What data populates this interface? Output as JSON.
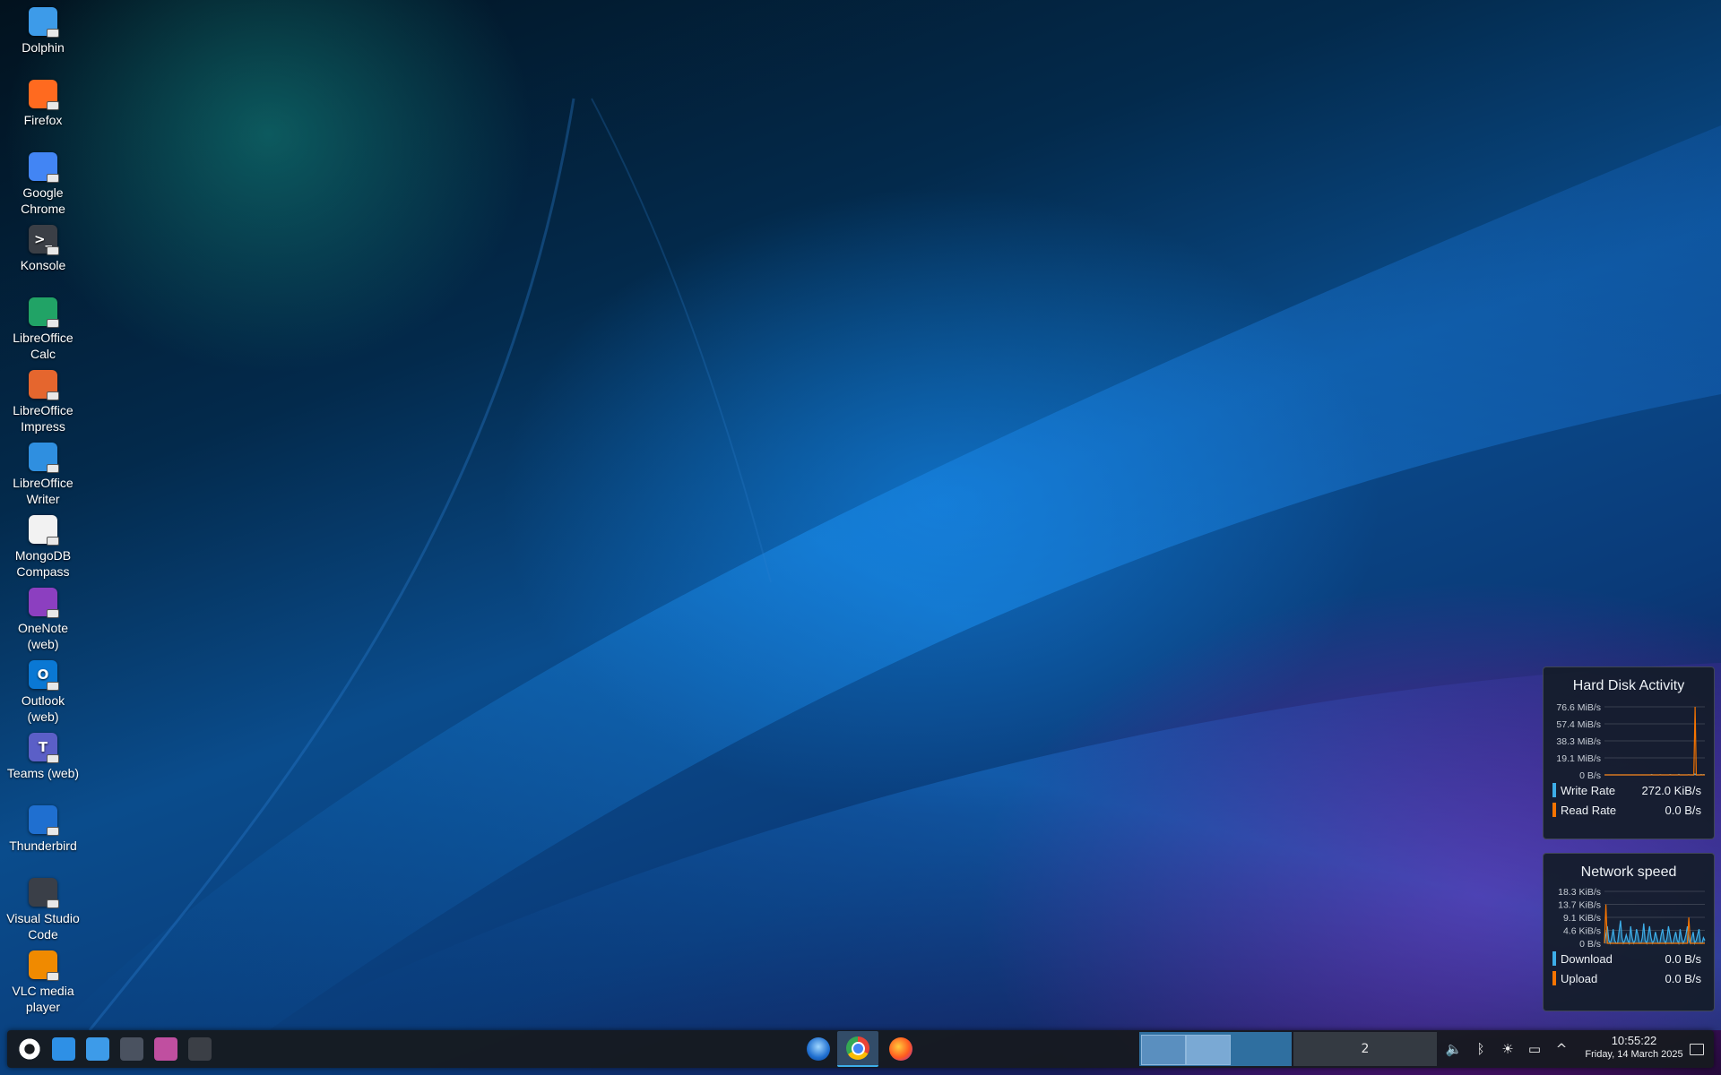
{
  "desktop_icons": [
    {
      "label": "Dolphin",
      "icon": "folder-icon",
      "color": "#3d9be9",
      "glyph": ""
    },
    {
      "label": "Firefox",
      "icon": "firefox-icon",
      "color": "#ff6a1f",
      "glyph": ""
    },
    {
      "label": "Google Chrome",
      "icon": "chrome-icon",
      "color": "#4285f4",
      "glyph": ""
    },
    {
      "label": "Konsole",
      "icon": "terminal-icon",
      "color": "#3b3f46",
      "glyph": ">_"
    },
    {
      "label": "LibreOffice Calc",
      "icon": "spreadsheet-icon",
      "color": "#21a366",
      "glyph": ""
    },
    {
      "label": "LibreOffice Impress",
      "icon": "presentation-icon",
      "color": "#e5662e",
      "glyph": ""
    },
    {
      "label": "LibreOffice Writer",
      "icon": "document-icon",
      "color": "#2f8fe0",
      "glyph": ""
    },
    {
      "label": "MongoDB Compass",
      "icon": "mongodb-leaf-icon",
      "color": "#f2f2f2",
      "glyph": ""
    },
    {
      "label": "OneNote (web)",
      "icon": "onenote-icon",
      "color": "#8c3fc0",
      "glyph": ""
    },
    {
      "label": "Outlook (web)",
      "icon": "outlook-icon",
      "color": "#0a78d4",
      "glyph": "O"
    },
    {
      "label": "Teams (web)",
      "icon": "teams-icon",
      "color": "#5b5fc7",
      "glyph": "T"
    },
    {
      "label": "Thunderbird",
      "icon": "thunderbird-icon",
      "color": "#1f6fd0",
      "glyph": ""
    },
    {
      "label": "Visual Studio Code",
      "icon": "vscode-icon",
      "color": "#3a3f48",
      "glyph": ""
    },
    {
      "label": "VLC media player",
      "icon": "vlc-cone-icon",
      "color": "#f08a00",
      "glyph": ""
    }
  ],
  "disk_widget": {
    "title": "Hard Disk Activity",
    "y_ticks": [
      "76.6 MiB/s",
      "57.4 MiB/s",
      "38.3 MiB/s",
      "19.1 MiB/s",
      "0 B/s"
    ],
    "legend": [
      {
        "name": "Write Rate",
        "value": "272.0 KiB/s",
        "color": "#3daee9"
      },
      {
        "name": "Read Rate",
        "value": "0.0 B/s",
        "color": "#f67400"
      }
    ]
  },
  "network_widget": {
    "title": "Network speed",
    "y_ticks": [
      "18.3 KiB/s",
      "13.7 KiB/s",
      "9.1 KiB/s",
      "4.6 KiB/s",
      "0 B/s"
    ],
    "legend": [
      {
        "name": "Download",
        "value": "0.0 B/s",
        "color": "#3daee9"
      },
      {
        "name": "Upload",
        "value": "0.0 B/s",
        "color": "#f67400"
      }
    ]
  },
  "chart_data": [
    {
      "type": "line",
      "title": "Hard Disk Activity",
      "ylim": [
        0,
        76.6
      ],
      "unit": "MiB/s",
      "series": [
        {
          "name": "Write Rate",
          "values": [
            0,
            0,
            0,
            0,
            0,
            0,
            0,
            0,
            0,
            0,
            0,
            0,
            0,
            0,
            0,
            0,
            0,
            0,
            0,
            0,
            0,
            0,
            0,
            0,
            0,
            0,
            0,
            0,
            0,
            0,
            0,
            0,
            0,
            0,
            0,
            0,
            0,
            0,
            0.5,
            0,
            0,
            0,
            0,
            0,
            0,
            0.3,
            0,
            0,
            0,
            0,
            0,
            0,
            0,
            0.4,
            0,
            0,
            0,
            0,
            0,
            0,
            0.6,
            0,
            0,
            0,
            0,
            0,
            0,
            0,
            0.3,
            0,
            0,
            0,
            0,
            1.0,
            0,
            0,
            0,
            0,
            0.5,
            0,
            0.4,
            0
          ]
        },
        {
          "name": "Read Rate",
          "values": [
            0,
            0,
            0,
            0,
            0,
            0,
            0,
            0,
            0,
            0,
            0,
            0,
            0,
            0,
            0,
            0,
            0,
            0,
            0,
            0,
            0,
            0,
            0,
            0,
            0,
            0,
            0,
            0,
            0,
            0,
            0,
            0,
            0,
            0,
            0,
            0,
            0,
            0,
            0,
            0,
            0,
            0,
            0,
            0,
            0,
            0,
            0,
            0,
            0,
            0,
            0,
            0,
            0,
            0,
            0,
            0,
            0,
            0,
            0,
            0,
            0,
            0,
            0,
            0,
            0,
            0,
            0,
            0,
            0,
            0,
            0,
            0,
            0,
            0,
            76.6,
            0,
            0,
            0,
            0,
            0,
            0,
            0,
            0
          ]
        }
      ]
    },
    {
      "type": "area",
      "title": "Network speed",
      "ylim": [
        0,
        18.3
      ],
      "unit": "KiB/s",
      "series": [
        {
          "name": "Download",
          "values": [
            0,
            3,
            6,
            1,
            0,
            2,
            5,
            1,
            0,
            0,
            4,
            8,
            2,
            0,
            1,
            3,
            1,
            0,
            6,
            2,
            0,
            1,
            5,
            3,
            0,
            0,
            2,
            7,
            1,
            0,
            3,
            6,
            2,
            0,
            1,
            4,
            2,
            0,
            0,
            3,
            5,
            1,
            0,
            2,
            6,
            3,
            0,
            0,
            2,
            4,
            1,
            0,
            5,
            2,
            0,
            1,
            3,
            6,
            1,
            0,
            2,
            4,
            0,
            1,
            3,
            5,
            0,
            0,
            2,
            1
          ]
        },
        {
          "name": "Upload",
          "values": [
            0,
            13.7,
            0,
            0,
            0,
            0,
            0,
            0,
            0,
            0,
            0,
            0,
            0,
            0,
            0,
            0,
            0,
            0,
            0,
            0,
            0,
            0,
            0,
            0,
            0,
            0,
            0,
            0,
            0,
            0,
            0,
            0,
            0,
            0,
            0,
            0,
            0,
            0,
            0,
            0,
            0,
            0,
            0,
            0,
            0,
            0,
            0,
            0,
            0,
            0,
            0,
            0,
            0,
            0,
            0,
            0,
            0,
            0,
            9.1,
            0,
            0,
            0,
            0,
            0,
            0,
            0,
            0,
            0,
            0,
            0
          ]
        }
      ]
    }
  ],
  "taskbar": {
    "launchers": [
      {
        "name": "app-launcher",
        "icon": "kde-gear-icon",
        "color": "#ffffff"
      },
      {
        "name": "discover",
        "icon": "shopping-bag-icon",
        "color": "#2e90e6"
      },
      {
        "name": "dolphin",
        "icon": "folder-icon",
        "color": "#3d9be9"
      },
      {
        "name": "system-settings",
        "icon": "sliders-icon",
        "color": "#4a5260"
      },
      {
        "name": "monitor-app",
        "icon": "monitor-icon",
        "color": "#c04fa0"
      },
      {
        "name": "konsole",
        "icon": "terminal-icon",
        "color": "#3b3f46"
      }
    ],
    "tasks": [
      {
        "name": "thunderbird",
        "icon": "thunderbird-icon",
        "color": "#1f6fd0",
        "active": false
      },
      {
        "name": "chrome",
        "icon": "chrome-icon",
        "color": "#4285f4",
        "active": true
      },
      {
        "name": "firefox",
        "icon": "firefox-icon",
        "color": "#ff6a1f",
        "active": false
      }
    ],
    "pager": {
      "desktop2_label": "2"
    },
    "tray": [
      {
        "name": "volume",
        "icon": "speaker-icon",
        "glyph": "🔈"
      },
      {
        "name": "bluetooth",
        "icon": "bluetooth-icon",
        "glyph": "ᛒ"
      },
      {
        "name": "brightness",
        "icon": "brightness-icon",
        "glyph": "☀"
      },
      {
        "name": "display",
        "icon": "display-icon",
        "glyph": "▭"
      },
      {
        "name": "expand",
        "icon": "chevron-up-icon",
        "glyph": "^"
      }
    ],
    "clock": {
      "time": "10:55:22",
      "date": "Friday, 14 March 2025"
    }
  }
}
